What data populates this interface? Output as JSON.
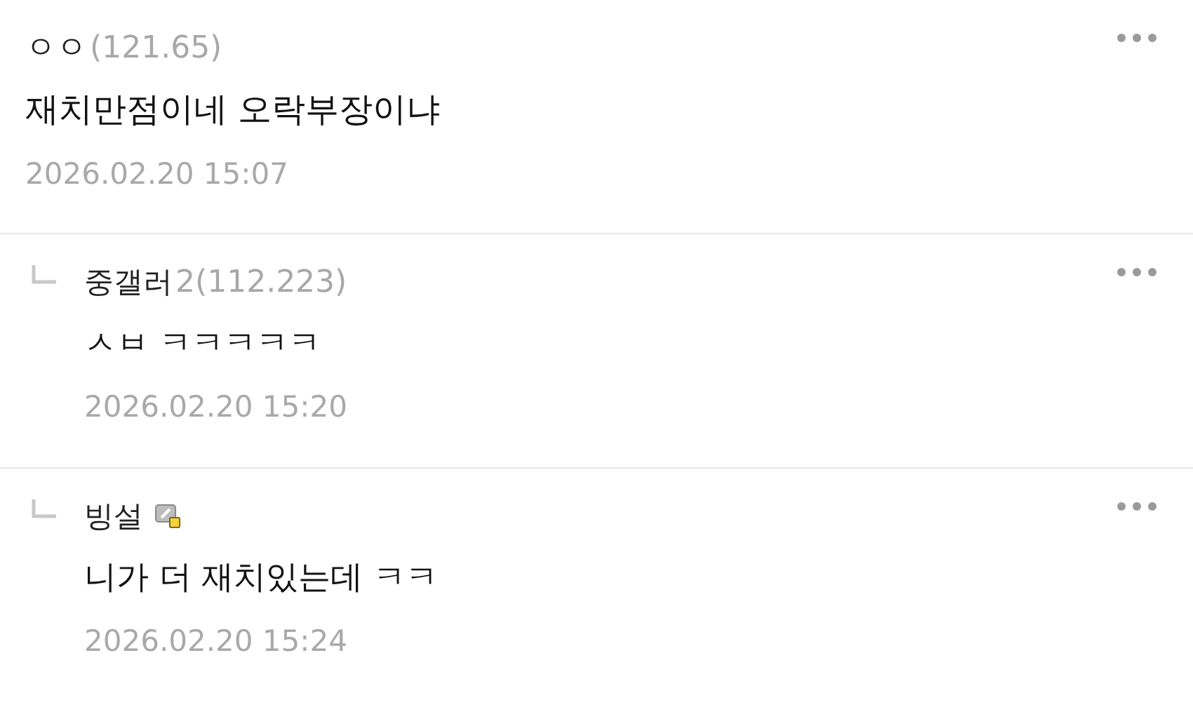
{
  "comments": [
    {
      "kind": "comment",
      "author": "ㅇㅇ",
      "ip": "(121.65)",
      "badge": false,
      "text": "재치만점이네 오락부장이냐",
      "date": "2026.02.20 15:07"
    },
    {
      "kind": "reply",
      "author": "중갤러",
      "ip": "2(112.223)",
      "badge": false,
      "text": "ㅅㅂ ㅋㅋㅋㅋㅋ",
      "date": "2026.02.20 15:20"
    },
    {
      "kind": "reply",
      "author": "빙설",
      "badge": true,
      "text": "니가 더 재치있는데 ㅋㅋ",
      "date": "2026.02.20 15:24"
    }
  ]
}
